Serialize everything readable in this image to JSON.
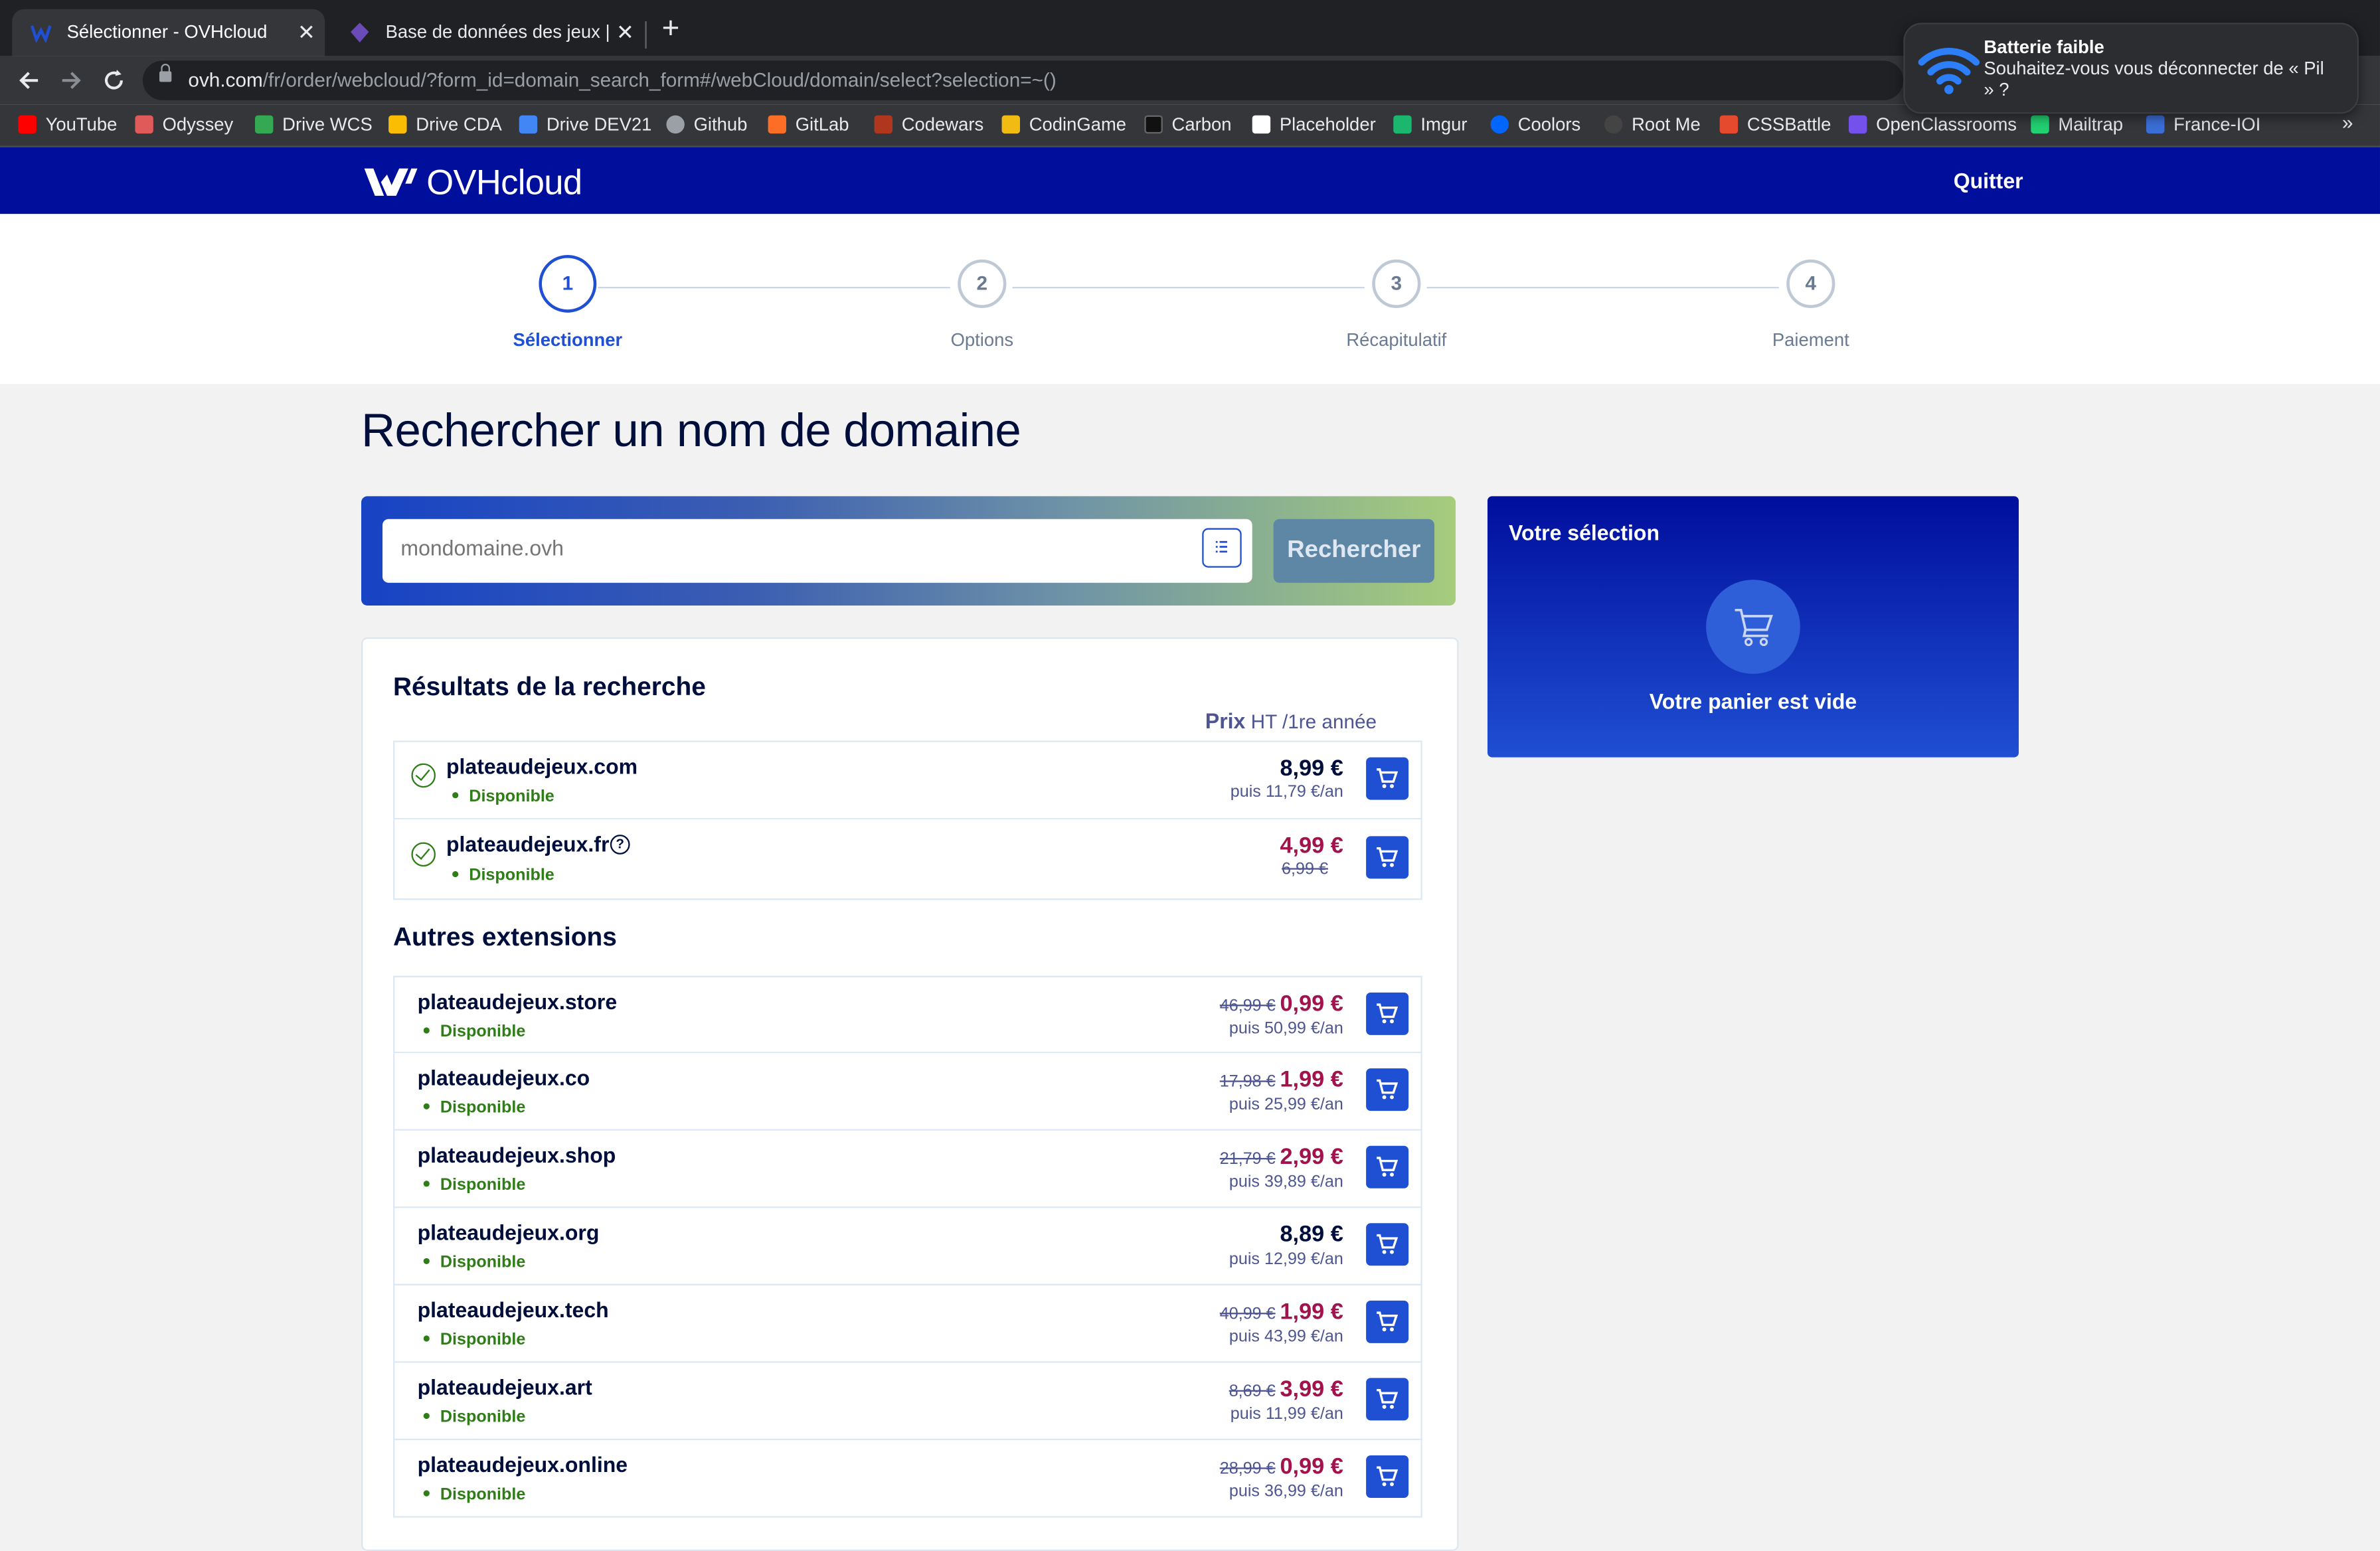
{
  "browser": {
    "tabs": [
      {
        "title": "Sélectionner - OVHcloud",
        "active": true
      },
      {
        "title": "Base de données des jeux | Ma",
        "active": false
      }
    ],
    "close_glyph": "✕",
    "new_tab_glyph": "+",
    "url_host": "ovh.com",
    "url_path": "/fr/order/webcloud/?form_id=domain_search_form#/webCloud/domain/select?selection=~()",
    "bookmarks": [
      {
        "label": "YouTube",
        "color": "#ff0000"
      },
      {
        "label": "Odyssey",
        "color": "#e05a5a"
      },
      {
        "label": "Drive WCS",
        "color": "#34a853"
      },
      {
        "label": "Drive CDA",
        "color": "#fbbc04"
      },
      {
        "label": "Drive DEV21",
        "color": "#4285f4"
      },
      {
        "label": "Github",
        "color": "#9aa0a6"
      },
      {
        "label": "GitLab",
        "color": "#fc6d26"
      },
      {
        "label": "Codewars",
        "color": "#b1361e"
      },
      {
        "label": "CodinGame",
        "color": "#f2bb13"
      },
      {
        "label": "Carbon",
        "color": "#111111"
      },
      {
        "label": "Placeholder",
        "color": "#ffffff"
      },
      {
        "label": "Imgur",
        "color": "#1bb76e"
      },
      {
        "label": "Coolors",
        "color": "#0066ff"
      },
      {
        "label": "Root Me",
        "color": "#444444"
      },
      {
        "label": "CSSBattle",
        "color": "#e64a2e"
      },
      {
        "label": "OpenClassrooms",
        "color": "#7451eb"
      },
      {
        "label": "Mailtrap",
        "color": "#22d172"
      },
      {
        "label": "France-IOI",
        "color": "#3b6fd8"
      }
    ],
    "more": "»"
  },
  "notification": {
    "title": "Batterie faible",
    "body": "Souhaitez-vous vous déconnecter de « Pil » ?",
    "icon": "wifi-icon"
  },
  "header": {
    "logo_text": "OVHcloud",
    "quit": "Quitter"
  },
  "steps": [
    {
      "num": "1",
      "label": "Sélectionner",
      "active": true
    },
    {
      "num": "2",
      "label": "Options",
      "active": false
    },
    {
      "num": "3",
      "label": "Récapitulatif",
      "active": false
    },
    {
      "num": "4",
      "label": "Paiement",
      "active": false
    }
  ],
  "page_title": "Rechercher un nom de domaine",
  "search": {
    "placeholder": "mondomaine.ovh",
    "value": "",
    "button": "Rechercher"
  },
  "selection": {
    "title": "Votre sélection",
    "empty": "Votre panier est vide"
  },
  "results": {
    "title": "Résultats de la recherche",
    "price_header": "Prix",
    "price_unit": "HT /1re année",
    "items": [
      {
        "domain": "plateaudejeux.com",
        "status": "Disponible",
        "price": "8,99 €",
        "promo": false,
        "old": "",
        "then": "puis 11,79 €/an",
        "help": false
      },
      {
        "domain": "plateaudejeux.fr",
        "status": "Disponible",
        "price": "4,99 €",
        "promo": true,
        "old": "",
        "old_line": "6,99 €",
        "then": "",
        "help": true
      }
    ]
  },
  "others": {
    "title": "Autres extensions",
    "items": [
      {
        "domain": "plateaudejeux.store",
        "status": "Disponible",
        "old": "46,99 €",
        "price": "0,99 €",
        "promo": true,
        "then": "puis 50,99 €/an"
      },
      {
        "domain": "plateaudejeux.co",
        "status": "Disponible",
        "old": "17,98 €",
        "price": "1,99 €",
        "promo": true,
        "then": "puis 25,99 €/an"
      },
      {
        "domain": "plateaudejeux.shop",
        "status": "Disponible",
        "old": "21,79 €",
        "price": "2,99 €",
        "promo": true,
        "then": "puis 39,89 €/an"
      },
      {
        "domain": "plateaudejeux.org",
        "status": "Disponible",
        "old": "",
        "price": "8,89 €",
        "promo": false,
        "then": "puis 12,99 €/an"
      },
      {
        "domain": "plateaudejeux.tech",
        "status": "Disponible",
        "old": "40,99 €",
        "price": "1,99 €",
        "promo": true,
        "then": "puis 43,99 €/an"
      },
      {
        "domain": "plateaudejeux.art",
        "status": "Disponible",
        "old": "8,69 €",
        "price": "3,99 €",
        "promo": true,
        "then": "puis 11,99 €/an"
      },
      {
        "domain": "plateaudejeux.online",
        "status": "Disponible",
        "old": "28,99 €",
        "price": "0,99 €",
        "promo": true,
        "then": "puis 36,99 €/an"
      }
    ]
  },
  "colors": {
    "brand": "#000e9c",
    "accent": "#1f4fd2",
    "promo": "#a2124d",
    "available": "#2e7d17"
  }
}
